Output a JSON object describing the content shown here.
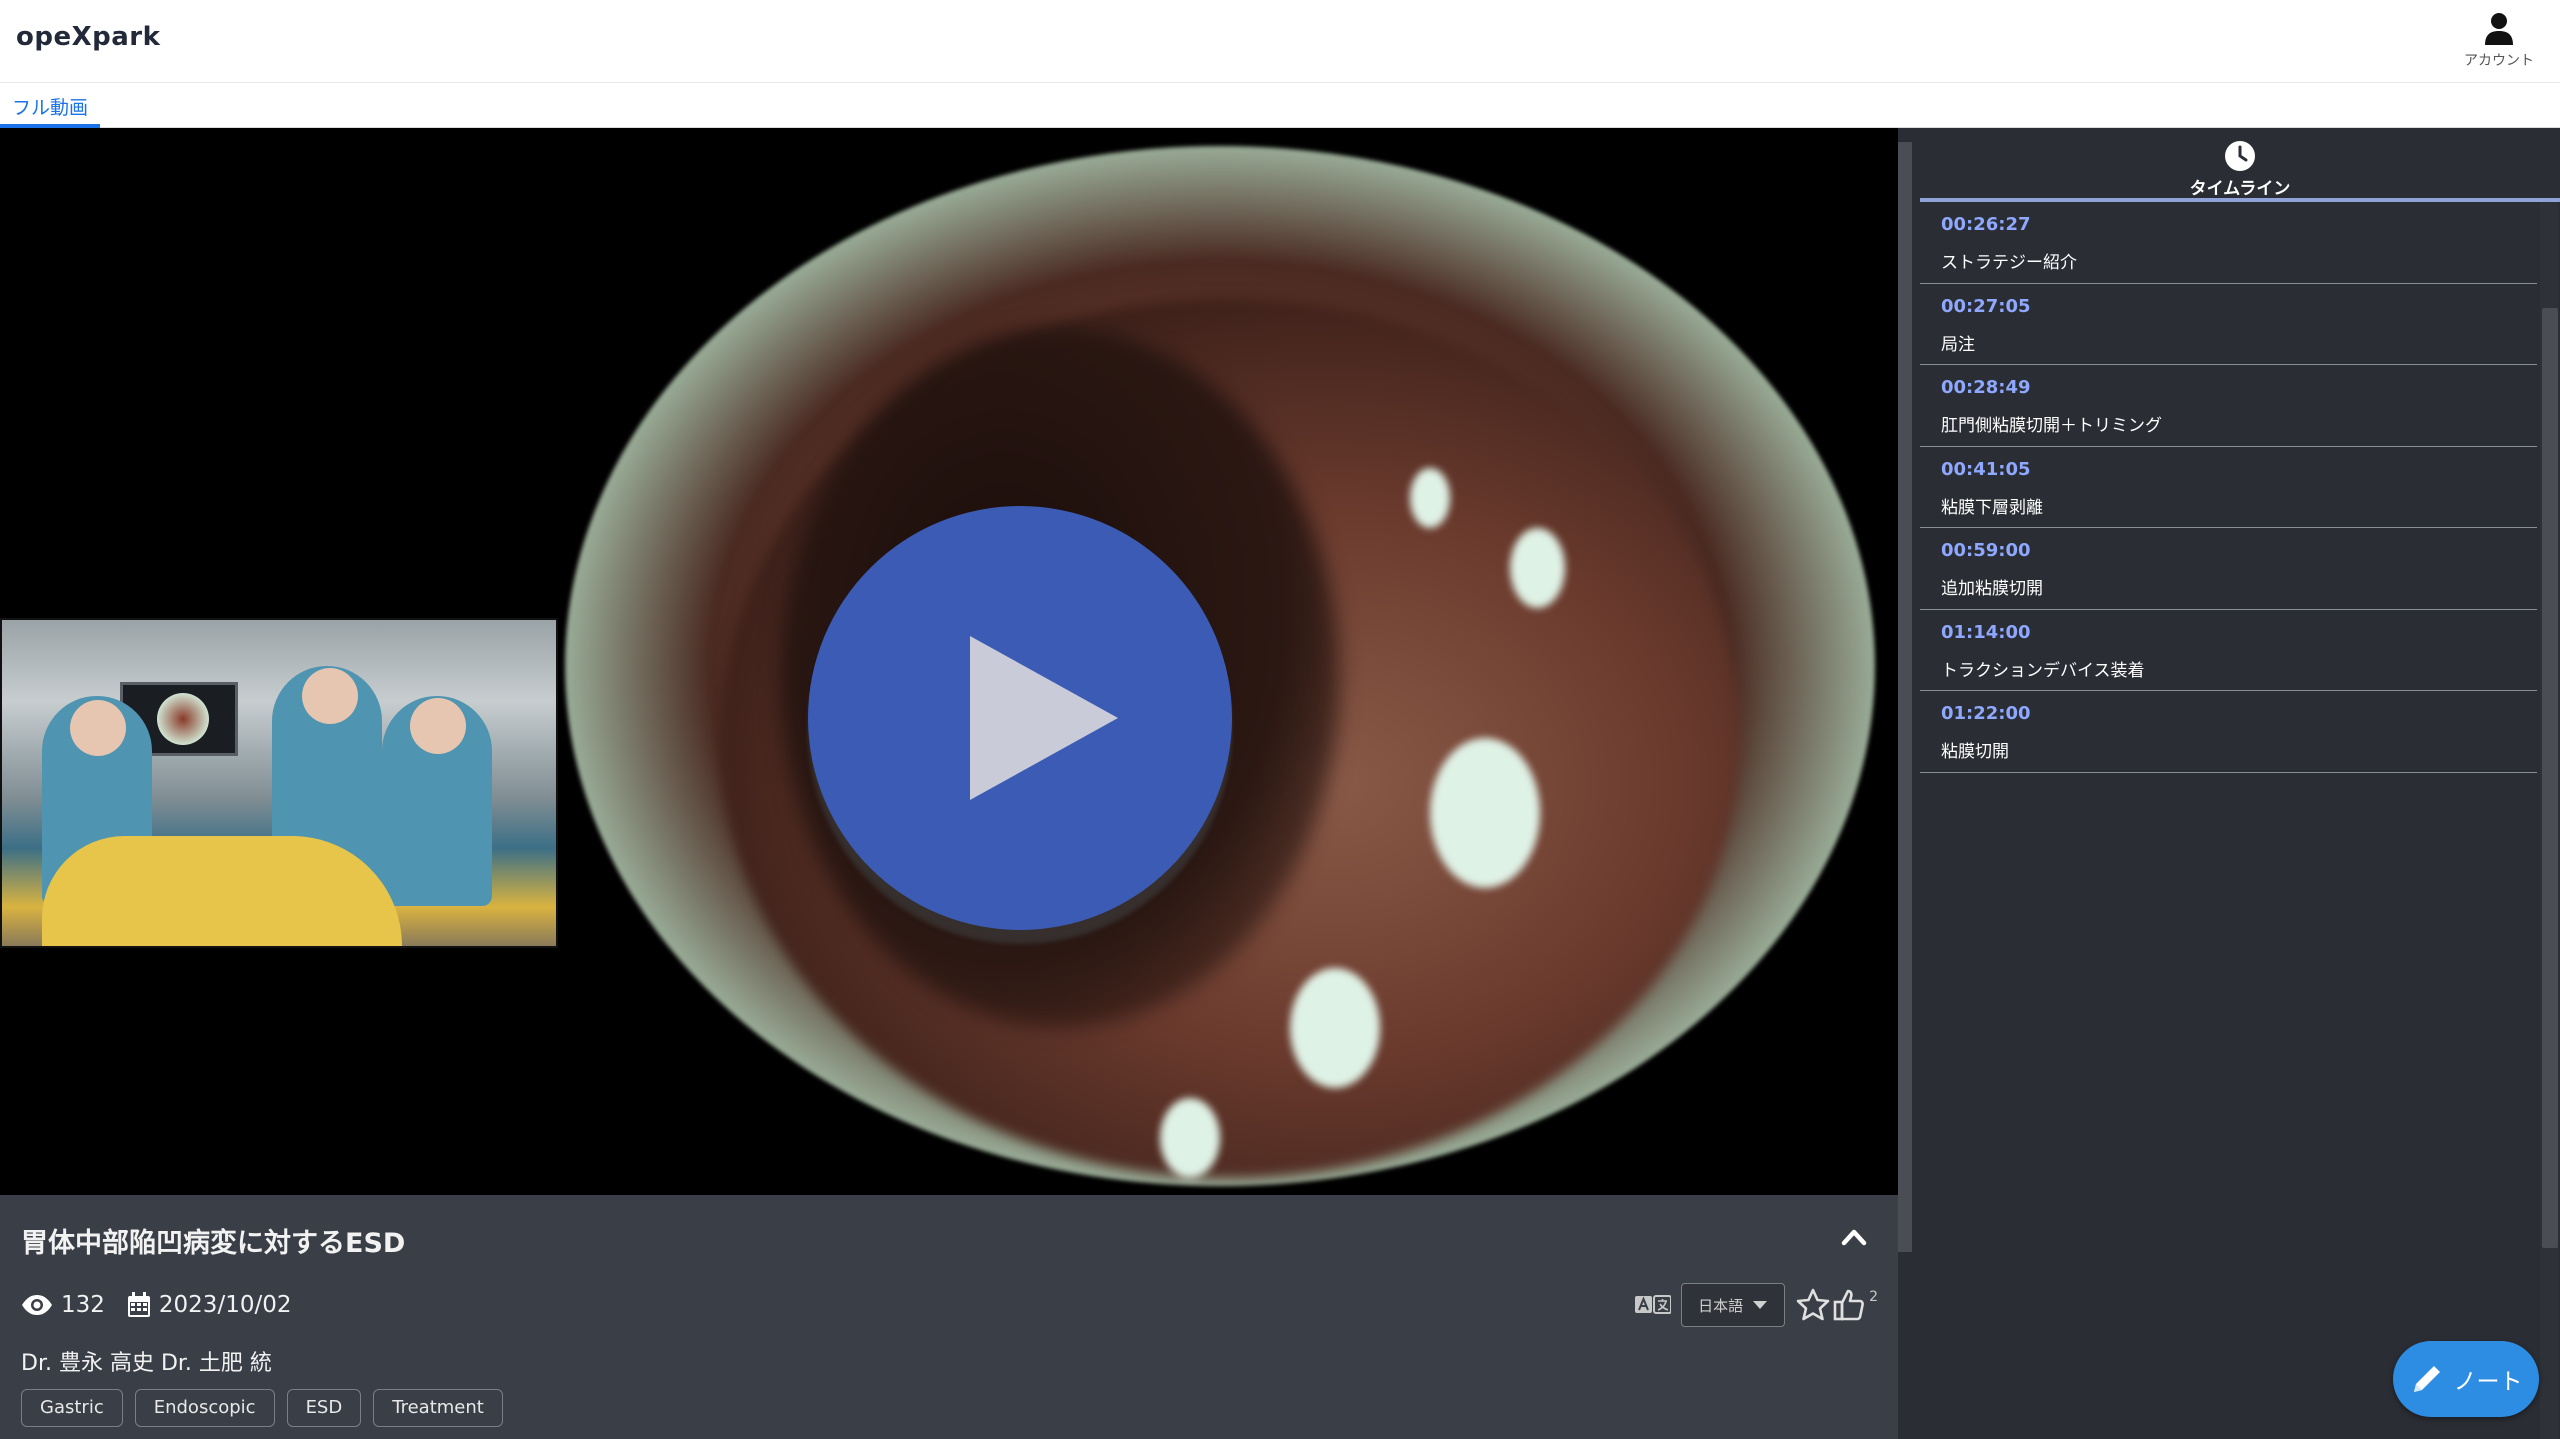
{
  "app": {
    "logo": "opeXpark"
  },
  "header": {
    "account_label": "アカウント"
  },
  "tabs": [
    {
      "label": "フル動画",
      "active": true
    }
  ],
  "video": {
    "state": "paused"
  },
  "info": {
    "title": "胃体中部陥凹病変に対するESD",
    "views": "132",
    "date": "2023/10/02",
    "authors": "Dr. 豊永 高史 Dr. 土肥 統",
    "tags": [
      "Gastric",
      "Endoscopic",
      "ESD",
      "Treatment"
    ],
    "language": "日本語",
    "likes": "2"
  },
  "timeline": {
    "header_label": "タイムライン",
    "items": [
      {
        "time": "00:26:27",
        "label": "ストラテジー紹介"
      },
      {
        "time": "00:27:05",
        "label": "局注"
      },
      {
        "time": "00:28:49",
        "label": "肛門側粘膜切開＋トリミング"
      },
      {
        "time": "00:41:05",
        "label": "粘膜下層剥離"
      },
      {
        "time": "00:59:00",
        "label": "追加粘膜切開"
      },
      {
        "time": "01:14:00",
        "label": "トラクションデバイス装着"
      },
      {
        "time": "01:22:00",
        "label": "粘膜切開"
      }
    ]
  },
  "note_button": {
    "label": "ノート"
  },
  "colors": {
    "accent": "#1a73e8",
    "timeline_time": "#8ea8ff",
    "play": "#3b5bb5",
    "note": "#2d8de2"
  },
  "icons": [
    "user-icon",
    "eye-icon",
    "calendar-icon",
    "chevron-up-icon",
    "translate-icon",
    "star-icon",
    "thumbs-up-icon",
    "clock-icon",
    "pencil-icon",
    "play-icon"
  ]
}
